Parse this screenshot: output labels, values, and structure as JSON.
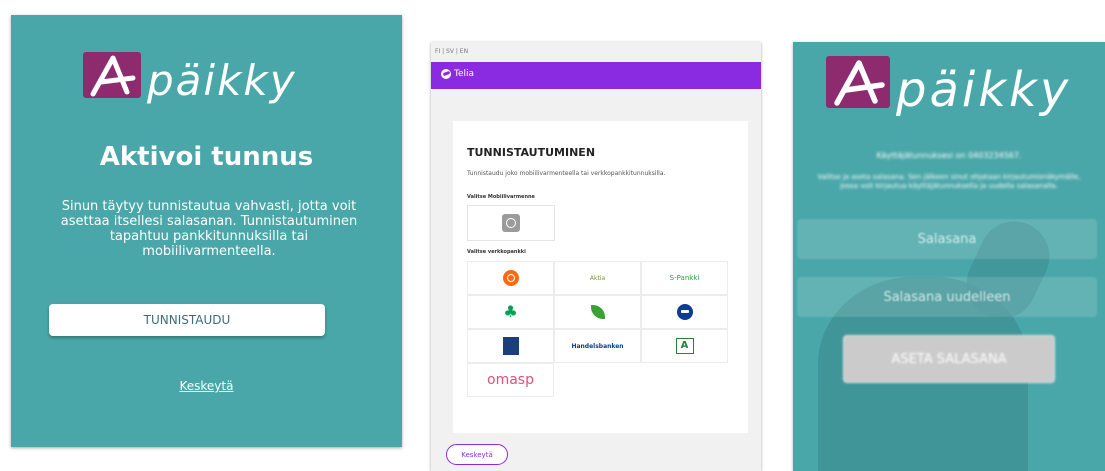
{
  "activate_screen": {
    "logo_text": "päikky",
    "title": "Aktivoi tunnus",
    "description": "Sinun täytyy tunnistautua vahvasti, jotta voit asettaa itsellesi salasanan. Tunnistautuminen tapahtuu pankkitunnuksilla tai mobiilivarmenteella.",
    "authenticate_button": "TUNNISTAUDU",
    "cancel_link": "Keskeytä"
  },
  "telia_screen": {
    "language_switcher": "FI | SV | EN",
    "brand": "Telia",
    "brand_color": "#8a2be2",
    "heading": "TUNNISTAUTUMINEN",
    "subheading": "Tunnistaudu joko mobiilivarmenteella tai verkkopankkitunnuksilla.",
    "mobile_section_label": "Valitse Mobiilivarmenne",
    "mobile_option": "mobiilivarmenne-icon",
    "bank_section_label": "Valitse verkkopankki",
    "banks": [
      {
        "name": "op-icon",
        "label": ""
      },
      {
        "name": "aktia-logo",
        "label": "Aktia"
      },
      {
        "name": "s-pankki-logo",
        "label": "S-Pankki"
      },
      {
        "name": "pop-pankki-icon",
        "label": ""
      },
      {
        "name": "danske-bank-icon",
        "label": ""
      },
      {
        "name": "nordea-icon",
        "label": ""
      },
      {
        "name": "alandsbanken-icon",
        "label": ""
      },
      {
        "name": "handelsbanken-logo",
        "label": "Handelsbanken"
      },
      {
        "name": "saastopankki-icon",
        "label": ""
      },
      {
        "name": "omasp-logo",
        "label": "omasp"
      }
    ],
    "cancel_button": "Keskeytä"
  },
  "password_screen": {
    "logo_text": "päikky",
    "username_line": "Käyttäjätunnuksesi on 0403234567.",
    "instructions": "Valitse ja aseta salasana. Sen jälkeen sinut ohjataan kirjautumisnäkymälle, jossa voit kirjautua käyttäjätunnuksella ja uudella salasanalla.",
    "password_placeholder": "Salasana",
    "password_again_placeholder": "Salasana uudelleen",
    "set_password_button": "ASETA SALASANA"
  },
  "colors": {
    "teal": "#4aa7a9",
    "logo_purple": "#8e2a6e"
  }
}
